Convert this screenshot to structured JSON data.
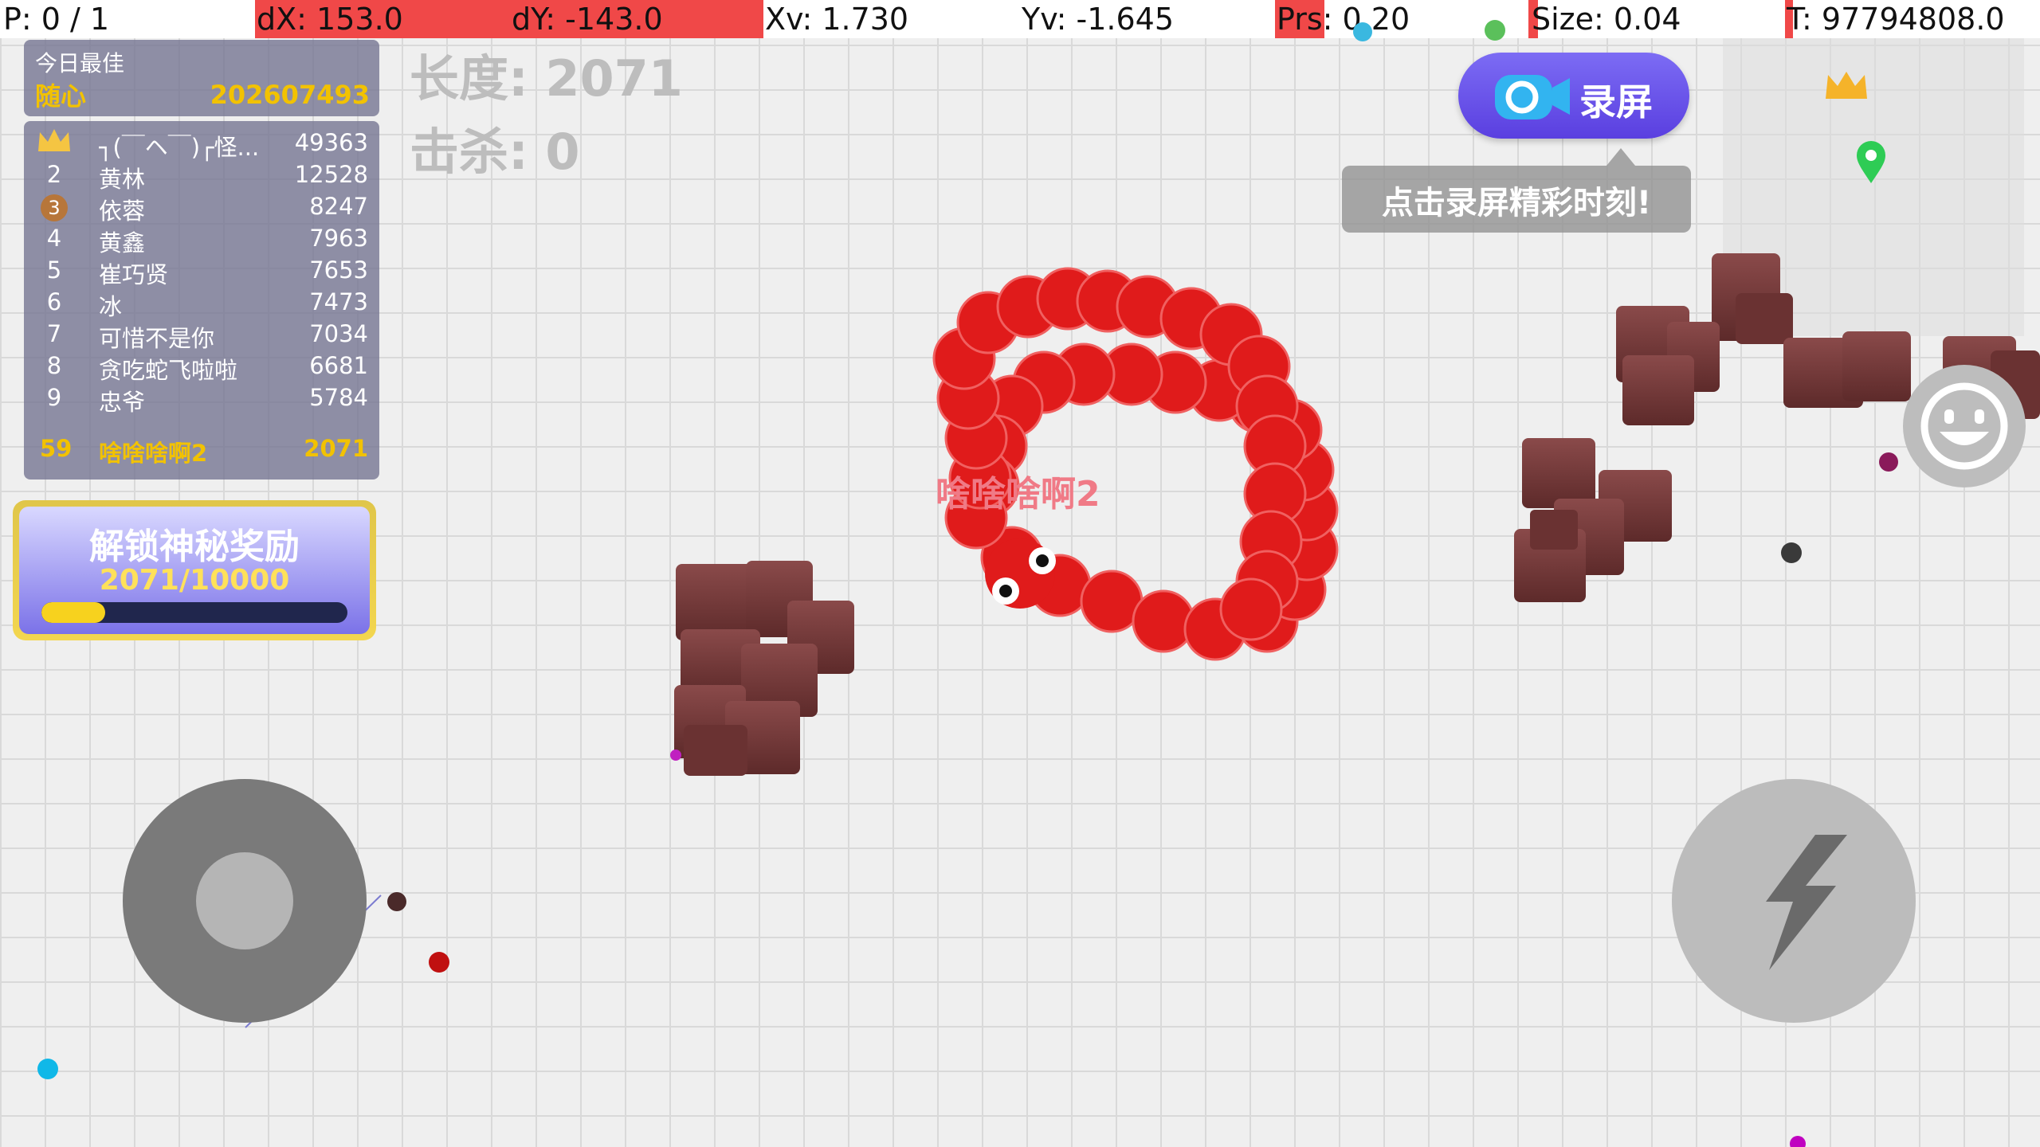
{
  "debug": {
    "p": "P: 0 / 1",
    "dx": "dX: 153.0",
    "dy": "dY: -143.0",
    "xv": "Xv: 1.730",
    "yv": "Yv: -1.645",
    "prs": "Prs: 0.20",
    "size": "Size: 0.04",
    "t": "T: 97794808.0"
  },
  "stats": {
    "length": "长度: 2071",
    "kills": "击杀: 0"
  },
  "best": {
    "title": "今日最佳",
    "name": "随心",
    "score": "202607493"
  },
  "leaderboard": [
    {
      "rank": "1",
      "name": "┐(￣ヘ￣)┌怪...",
      "score": "49363"
    },
    {
      "rank": "2",
      "name": "黄林",
      "score": "12528"
    },
    {
      "rank": "3",
      "name": "依蓉",
      "score": "8247"
    },
    {
      "rank": "4",
      "name": "黄鑫",
      "score": "7963"
    },
    {
      "rank": "5",
      "name": "崔巧贤",
      "score": "7653"
    },
    {
      "rank": "6",
      "name": "冰",
      "score": "7473"
    },
    {
      "rank": "7",
      "name": "可惜不是你",
      "score": "7034"
    },
    {
      "rank": "8",
      "name": "贪吃蛇飞啦啦",
      "score": "6681"
    },
    {
      "rank": "9",
      "name": "忠爷",
      "score": "5784"
    }
  ],
  "me": {
    "rank": "59",
    "name": "啥啥啥啊2",
    "score": "2071"
  },
  "unlock": {
    "title": "解锁神秘奖励",
    "progress_text": "2071/10000",
    "progress": 0.2071
  },
  "record": {
    "label": "录屏",
    "tip": "点击录屏精彩时刻!"
  },
  "snake": {
    "name": "啥啥啥啊2",
    "color": "#e01b1b"
  },
  "colors": {
    "debug_red": "#f04848",
    "gold": "#f2c200",
    "block": "#7a3a3a"
  },
  "icons": {
    "camera": "camera-icon",
    "crown": "crown-icon",
    "pin": "map-pin-icon",
    "boost": "lightning-icon",
    "emoji": "smiley-icon"
  }
}
